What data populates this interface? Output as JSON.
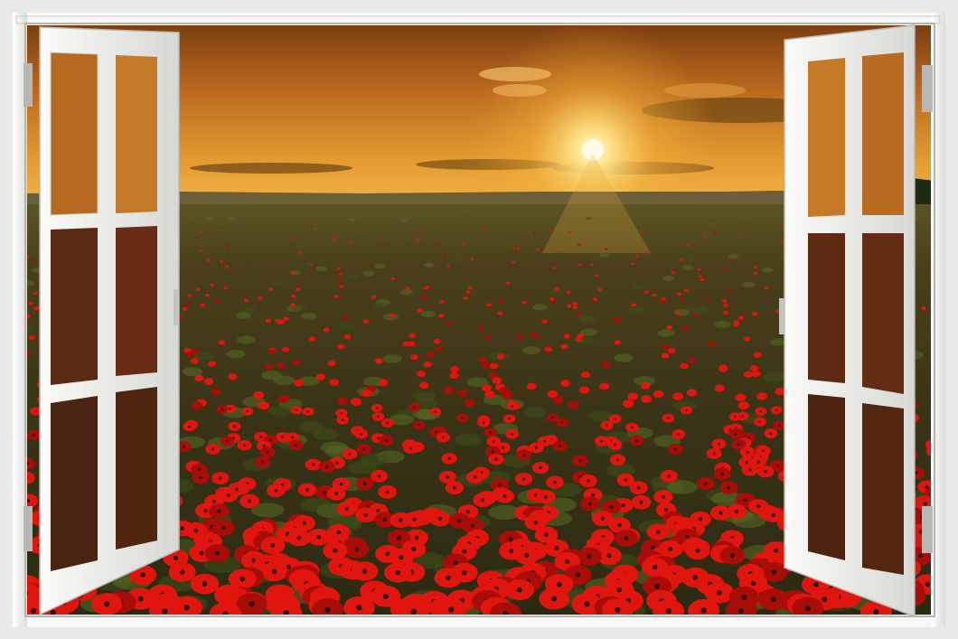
{
  "scene": {
    "description_icon": "window-view-icon",
    "colors": {
      "sky_top": "#8a4a12",
      "sky_mid": "#d9892a",
      "horizon": "#f2b23a",
      "sun": "#fff6c8",
      "field_dark": "#2f2a14",
      "field_mid": "#4d4a1e",
      "poppy": "#e0150e",
      "poppy_dark": "#a80d08",
      "frame": "#f4f4f2",
      "frame_shadow": "#bdbdb9",
      "wall": "#e9e9e7"
    }
  }
}
